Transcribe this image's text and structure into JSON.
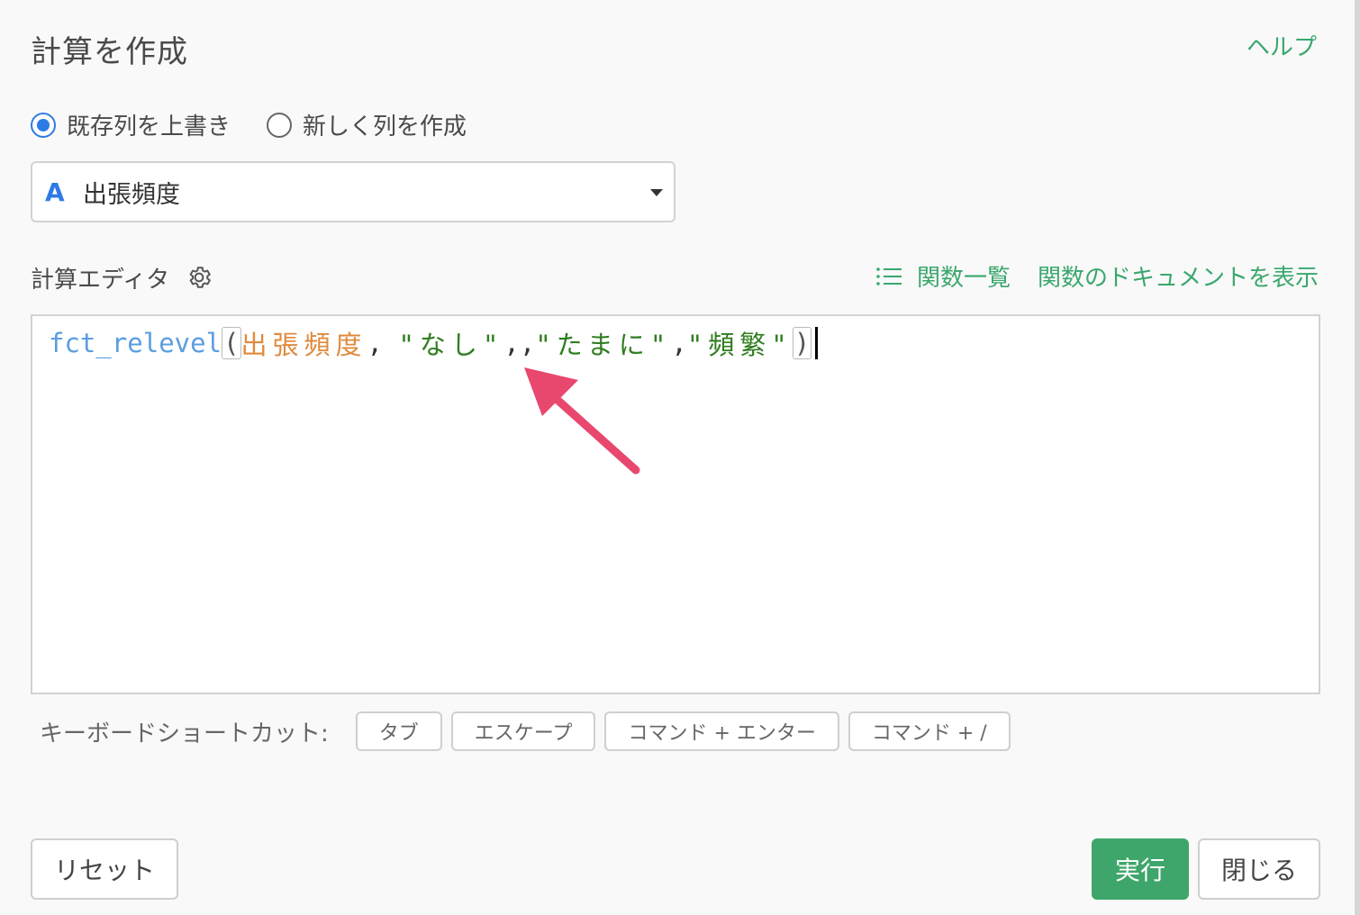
{
  "dialog": {
    "title": "計算を作成",
    "help_link": "ヘルプ"
  },
  "mode": {
    "options": [
      {
        "label": "既存列を上書き",
        "selected": true
      },
      {
        "label": "新しく列を作成",
        "selected": false
      }
    ]
  },
  "column_select": {
    "type_icon": "A",
    "value": "出張頻度"
  },
  "editor": {
    "label": "計算エディタ",
    "function_list_link": "関数一覧",
    "docs_link": "関数のドキュメントを表示",
    "code": {
      "function": "fct_relevel",
      "open_paren": "(",
      "column": "出張頻度",
      "sep1": ", ",
      "arg1": "\"なし\"",
      "sep2": ",,",
      "arg2": "\"たまに\"",
      "sep3": ",",
      "arg3": "\"頻繁\"",
      "close_paren": ")"
    }
  },
  "shortcuts": {
    "label": "キーボードショートカット:",
    "keys": [
      "タブ",
      "エスケープ",
      "コマンド + エンター",
      "コマンド + /"
    ]
  },
  "footer": {
    "reset": "リセット",
    "run": "実行",
    "close": "閉じる"
  },
  "colors": {
    "accent_green": "#3aa76d",
    "radio_blue": "#2f7be5",
    "annotation_arrow": "#e8476e"
  }
}
